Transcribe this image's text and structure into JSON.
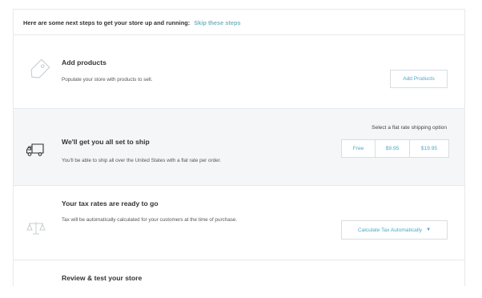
{
  "header": {
    "text": "Here are some next steps to get your store up and running:",
    "skip_link": "Skip these steps"
  },
  "steps": {
    "add_products": {
      "title": "Add products",
      "description": "Populate your store with products to sell.",
      "button": "Add Products",
      "icon": "tag-icon"
    },
    "shipping": {
      "title": "We'll get you all set to ship",
      "description": "You'll be able to ship all over the United States with a flat rate per order.",
      "option_label": "Select a flat rate shipping option",
      "options": [
        "Free",
        "$9.95",
        "$19.95"
      ],
      "icon": "truck-icon"
    },
    "tax": {
      "title": "Your tax rates are ready to go",
      "description": "Tax will be automatically calculated for your customers at the time of purchase.",
      "button": "Calculate Tax Automatically",
      "icon": "scale-icon"
    },
    "review": {
      "title": "Review & test your store"
    }
  },
  "colors": {
    "accent": "#4aa9c9",
    "skip_link": "#79b6c0",
    "shaded_section": "#f5f6f7",
    "border": "#e6e9ec"
  }
}
